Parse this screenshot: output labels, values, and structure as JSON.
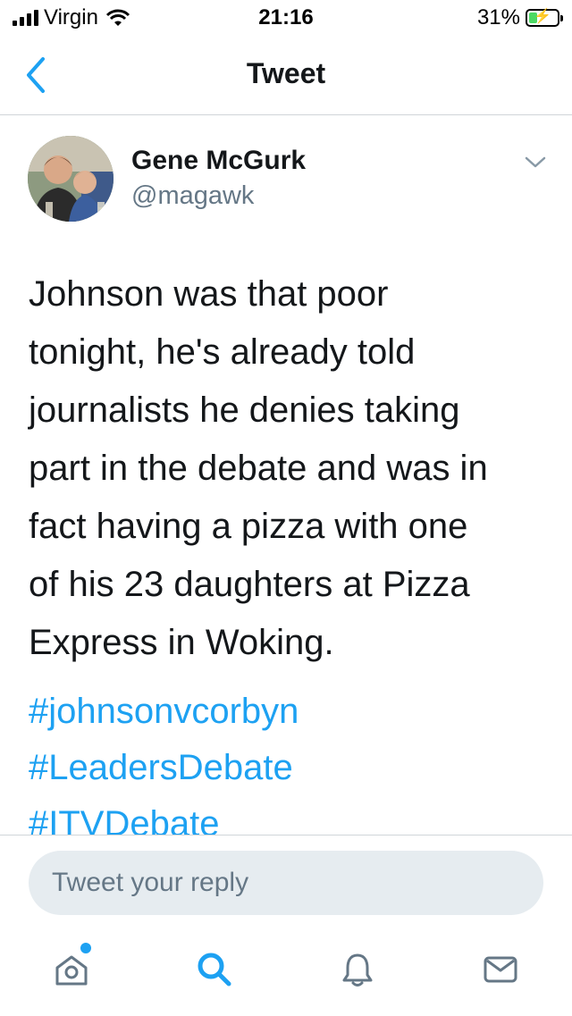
{
  "status_bar": {
    "carrier": "Virgin",
    "time": "21:16",
    "battery_percent": "31%",
    "battery_level": 0.31
  },
  "nav": {
    "title": "Tweet",
    "back_icon": "chevron-left-icon"
  },
  "tweet": {
    "display_name": "Gene McGurk",
    "handle": "@magawk",
    "text": "Johnson was that poor\ntonight, he's already told\njournalists he denies taking\npart in the debate and was in\nfact having a pizza with one\nof his 23 daughters at Pizza\nExpress in Woking.",
    "hashtags": [
      "#johnsonvcorbyn",
      "#LeadersDebate",
      "#ITVDebate"
    ]
  },
  "reply": {
    "placeholder": "Tweet your reply"
  },
  "tab_bar": {
    "items": [
      {
        "icon": "home-icon",
        "has_notification_dot": true
      },
      {
        "icon": "search-icon"
      },
      {
        "icon": "bell-icon"
      },
      {
        "icon": "mail-icon"
      }
    ]
  },
  "colors": {
    "accent": "#1da1f2",
    "text": "#14171a",
    "secondary": "#657786",
    "divider": "#d0d5d9",
    "input_bg": "#e6ecf0"
  }
}
